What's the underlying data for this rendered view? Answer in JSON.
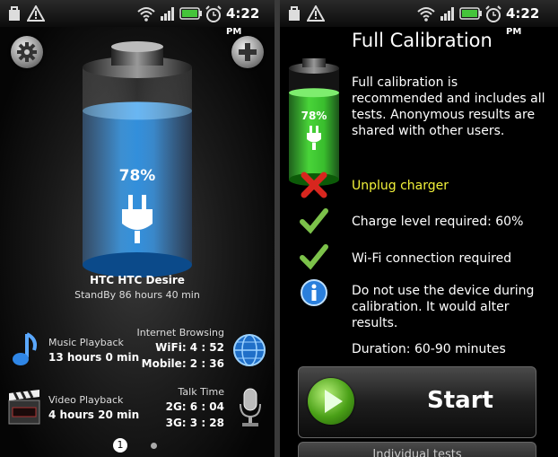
{
  "status_bar": {
    "time": "4:22",
    "ampm": "PM",
    "icons": [
      "bag-icon",
      "alert-triangle-icon",
      "wifi-icon",
      "signal-icon",
      "battery-icon",
      "alarm-clock-icon"
    ]
  },
  "left": {
    "settings_icon": "gear-icon",
    "add_icon": "plus-icon",
    "battery_level_fraction": 0.78,
    "battery_percent": "78%",
    "device_name": "HTC HTC Desire",
    "standby": "StandBy 86 hours 40 min",
    "music": {
      "label": "Music Playback",
      "value": "13 hours 0 min"
    },
    "video": {
      "label": "Video Playback",
      "value": "4 hours 20 min"
    },
    "internet": {
      "label": "Internet Browsing",
      "wifi": "WiFi: 4 : 52",
      "mobile": "Mobile: 2 : 36"
    },
    "talk": {
      "label": "Talk Time",
      "g2": "2G: 6 : 04",
      "g3": "3G: 3 : 28"
    },
    "pager": {
      "current": "1",
      "total": 2
    }
  },
  "right": {
    "title": "Full Calibration",
    "battery_percent": "78%",
    "description": "Full calibration is recommended and includes all tests. Anonymous results are shared with other users.",
    "items": [
      {
        "icon": "cross-icon",
        "text": "Unplug charger",
        "color": "#f2f23a"
      },
      {
        "icon": "checkmark-icon",
        "text": "Charge level required: 60%",
        "color": "#ffffff"
      },
      {
        "icon": "checkmark-icon",
        "text": "Wi-Fi connection required",
        "color": "#ffffff"
      },
      {
        "icon": "info-icon",
        "text": "Do not use the device during calibration. It would alter results.",
        "color": "#ffffff"
      }
    ],
    "duration": "Duration: 60-90 minutes",
    "start_label": "Start",
    "second_label": "Individual tests"
  }
}
